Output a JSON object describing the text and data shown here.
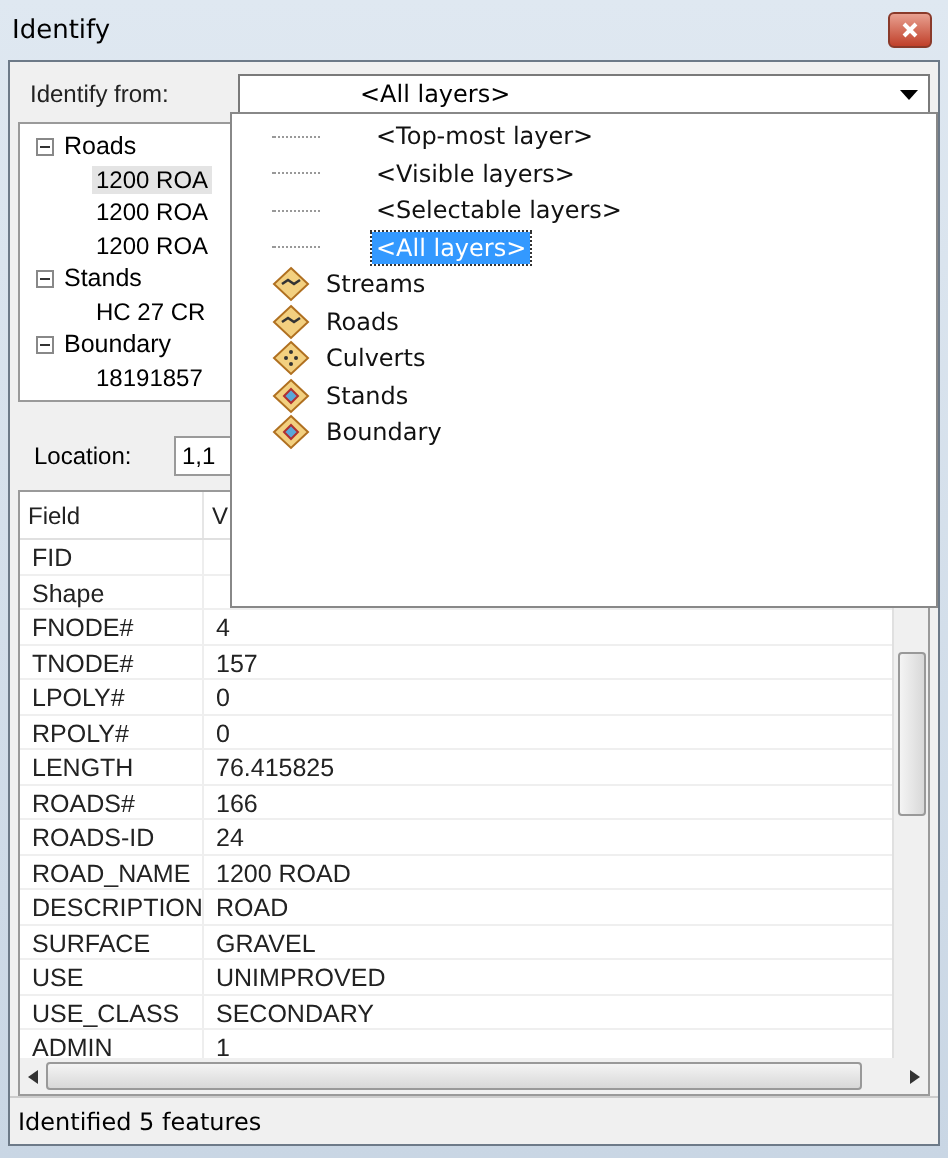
{
  "window": {
    "title": "Identify"
  },
  "identify_from": {
    "label": "Identify from:",
    "value": "<All layers>"
  },
  "tree": [
    {
      "label": "Roads",
      "expanded": true,
      "children": [
        {
          "label": "1200 ROA",
          "selected": true
        },
        {
          "label": "1200 ROA",
          "selected": false
        },
        {
          "label": "1200 ROA",
          "selected": false
        }
      ]
    },
    {
      "label": "Stands",
      "expanded": true,
      "children": [
        {
          "label": "HC 27 CR",
          "selected": false
        }
      ]
    },
    {
      "label": "Boundary",
      "expanded": true,
      "children": [
        {
          "label": "18191857",
          "selected": false
        }
      ]
    }
  ],
  "location": {
    "label": "Location:",
    "value": "1,1"
  },
  "table": {
    "columns": [
      "Field",
      "V"
    ],
    "rows": [
      [
        "FID",
        ""
      ],
      [
        "Shape",
        ""
      ],
      [
        "FNODE#",
        "4"
      ],
      [
        "TNODE#",
        "157"
      ],
      [
        "LPOLY#",
        "0"
      ],
      [
        "RPOLY#",
        "0"
      ],
      [
        "LENGTH",
        "76.415825"
      ],
      [
        "ROADS#",
        "166"
      ],
      [
        "ROADS-ID",
        "24"
      ],
      [
        "ROAD_NAME",
        "1200 ROAD"
      ],
      [
        "DESCRIPTION",
        "ROAD"
      ],
      [
        "SURFACE",
        "GRAVEL"
      ],
      [
        "USE",
        "UNIMPROVED"
      ],
      [
        "USE_CLASS",
        "SECONDARY"
      ],
      [
        "ADMIN",
        "1"
      ]
    ]
  },
  "dropdown": [
    {
      "kind": "option",
      "label": "<Top-most layer>",
      "selected": false
    },
    {
      "kind": "option",
      "label": "<Visible layers>",
      "selected": false
    },
    {
      "kind": "option",
      "label": "<Selectable layers>",
      "selected": false
    },
    {
      "kind": "option",
      "label": "<All layers>",
      "selected": true
    },
    {
      "kind": "line",
      "label": "Streams",
      "selected": false
    },
    {
      "kind": "line",
      "label": "Roads",
      "selected": false
    },
    {
      "kind": "point",
      "label": "Culverts",
      "selected": false
    },
    {
      "kind": "polygon",
      "label": "Stands",
      "selected": false
    },
    {
      "kind": "polygon",
      "label": "Boundary",
      "selected": false
    }
  ],
  "status_bar": "Identified 5 features"
}
